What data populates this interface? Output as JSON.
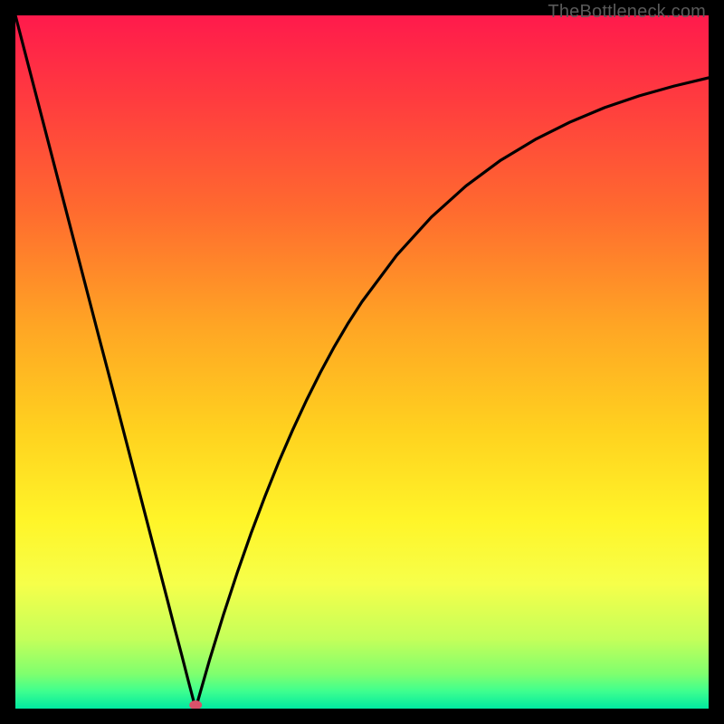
{
  "watermark": "TheBottleneck.com",
  "chart_data": {
    "type": "line",
    "title": "",
    "xlabel": "",
    "ylabel": "",
    "xlim": [
      0,
      100
    ],
    "ylim": [
      0,
      100
    ],
    "x": [
      0,
      2,
      4,
      6,
      8,
      10,
      12,
      14,
      16,
      18,
      20,
      22,
      23,
      24,
      25,
      26,
      28,
      30,
      32,
      34,
      36,
      38,
      40,
      42,
      44,
      46,
      48,
      50,
      55,
      60,
      65,
      70,
      75,
      80,
      85,
      90,
      95,
      100
    ],
    "y": [
      100,
      92.3,
      84.6,
      76.9,
      69.2,
      61.5,
      53.8,
      46.2,
      38.5,
      30.8,
      23.1,
      15.4,
      11.5,
      7.7,
      3.8,
      0.0,
      7.0,
      13.5,
      19.6,
      25.3,
      30.6,
      35.6,
      40.2,
      44.5,
      48.5,
      52.2,
      55.6,
      58.7,
      65.4,
      70.9,
      75.4,
      79.1,
      82.1,
      84.6,
      86.7,
      88.4,
      89.8,
      91.0
    ],
    "marker": {
      "x": 26,
      "y": 0,
      "color": "#d9526a"
    },
    "gradient_stops": [
      {
        "offset": 0.0,
        "color": "#ff1a4c"
      },
      {
        "offset": 0.12,
        "color": "#ff3b3f"
      },
      {
        "offset": 0.28,
        "color": "#ff6a2f"
      },
      {
        "offset": 0.45,
        "color": "#ffa624"
      },
      {
        "offset": 0.6,
        "color": "#ffd21f"
      },
      {
        "offset": 0.73,
        "color": "#fff529"
      },
      {
        "offset": 0.82,
        "color": "#f6ff4a"
      },
      {
        "offset": 0.9,
        "color": "#c4ff5a"
      },
      {
        "offset": 0.95,
        "color": "#7fff6e"
      },
      {
        "offset": 0.975,
        "color": "#3eff8f"
      },
      {
        "offset": 1.0,
        "color": "#00e8a0"
      }
    ]
  }
}
